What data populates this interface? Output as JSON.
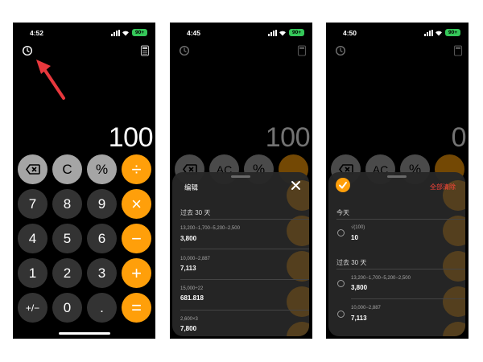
{
  "colors": {
    "operator": "#ff9f0a",
    "function": "#a5a5a5",
    "number": "#333333",
    "clear_all": "#ff453a",
    "battery": "#35c759"
  },
  "screen1": {
    "time": "4:52",
    "battery": "90+",
    "display": "100",
    "icons": [
      "history-icon",
      "calculator-icon"
    ],
    "keys": {
      "backspace": "⌫",
      "clear": "C",
      "percent": "%",
      "divide": "÷",
      "n7": "7",
      "n8": "8",
      "n9": "9",
      "multiply": "×",
      "n4": "4",
      "n5": "5",
      "n6": "6",
      "minus": "−",
      "n1": "1",
      "n2": "2",
      "n3": "3",
      "plus": "+",
      "sign": "+/−",
      "n0": "0",
      "dot": ".",
      "equals": "="
    }
  },
  "screen2": {
    "time": "4:45",
    "battery": "90+",
    "display": "100",
    "keys": {
      "ac": "AC",
      "percent": "%"
    },
    "sheet": {
      "edit": "编辑",
      "section": "过去 30 天",
      "items": [
        {
          "expr": "13,200−1,700−5,200−2,500",
          "result": "3,800"
        },
        {
          "expr": "10,000−2,887",
          "result": "7,113"
        },
        {
          "expr": "15,000÷22",
          "result": "681.818"
        },
        {
          "expr": "2,600×3",
          "result": "7,800"
        }
      ]
    }
  },
  "screen3": {
    "time": "4:50",
    "battery": "90+",
    "display": "0",
    "keys": {
      "ac": "AC",
      "percent": "%"
    },
    "sheet": {
      "clear_all": "全部清除",
      "today": "今天",
      "today_items": [
        {
          "expr": "√(100)",
          "result": "10"
        }
      ],
      "section": "过去 30 天",
      "items": [
        {
          "expr": "13,200−1,700−5,200−2,500",
          "result": "3,800"
        },
        {
          "expr": "10,000−2,887",
          "result": "7,113"
        }
      ]
    }
  }
}
